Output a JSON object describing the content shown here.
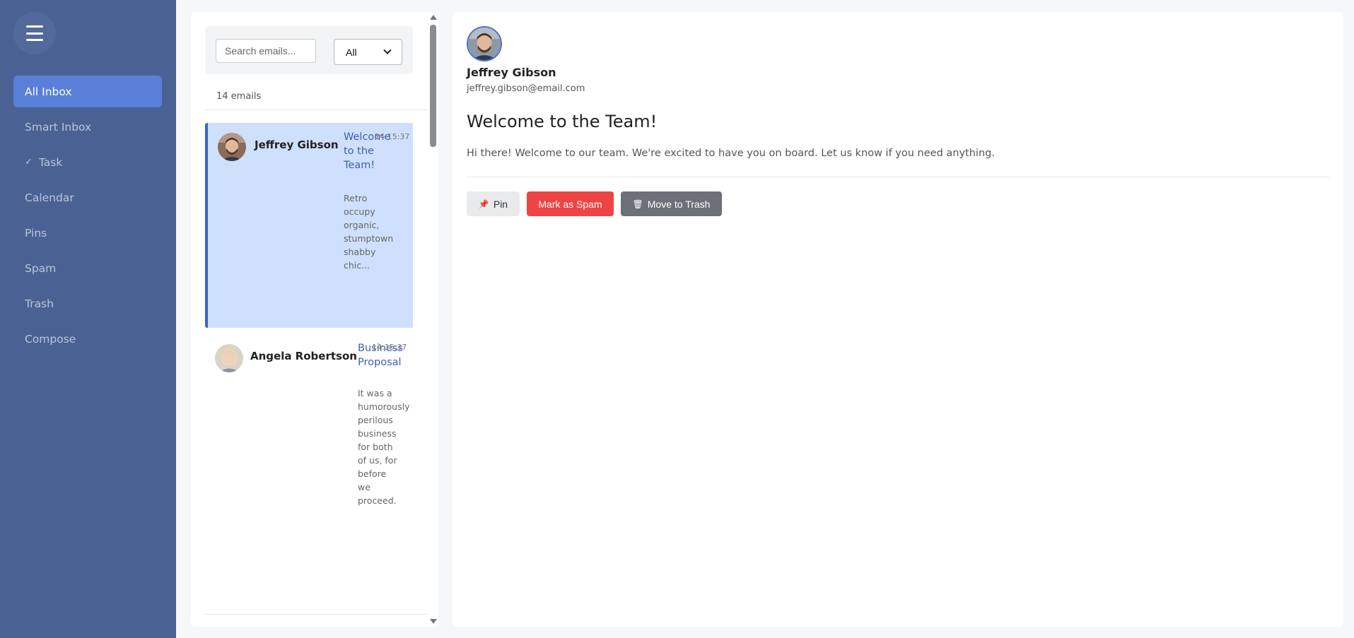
{
  "sidebar": {
    "items": [
      {
        "label": "All Inbox",
        "active": true
      },
      {
        "label": "Smart Inbox"
      },
      {
        "label": "Task",
        "icon": "check-icon",
        "icon_glyph": "✓"
      },
      {
        "label": "Calendar"
      },
      {
        "label": "Pins"
      },
      {
        "label": "Spam"
      },
      {
        "label": "Trash"
      },
      {
        "label": "Compose"
      }
    ]
  },
  "list": {
    "search_placeholder": "Search emails...",
    "filter_value": "All",
    "count": "14 emails",
    "emails": [
      {
        "sender": "Jeffrey Gibson",
        "subject": "Welcome to the Team!",
        "time": "14:15:37",
        "preview": "Retro occupy organic, stumptown shabby chic...",
        "selected": true
      },
      {
        "sender": "Angela Robertson",
        "subject": "Business Proposal",
        "time": "14:15:37",
        "preview": "It was a humorously perilous business for both of us, for before we proceed."
      }
    ]
  },
  "detail": {
    "sender_name": "Jeffrey Gibson",
    "sender_email": "jeffrey.gibson@email.com",
    "subject": "Welcome to the Team!",
    "body": "Hi there! Welcome to our team. We're excited to have you on board. Let us know if you need anything.",
    "actions": {
      "pin": "Pin",
      "pin_icon": "📌",
      "spam": "Mark as Spam",
      "trash": "Move to Trash",
      "trash_icon": "🗑"
    }
  },
  "colors": {
    "sidebar_bg": "#4a6293",
    "active_nav": "#5a7fd9",
    "selected_email": "#cfe0fc",
    "accent": "#3d63c9",
    "spam": "#ef4444",
    "trash": "#6b7079"
  }
}
